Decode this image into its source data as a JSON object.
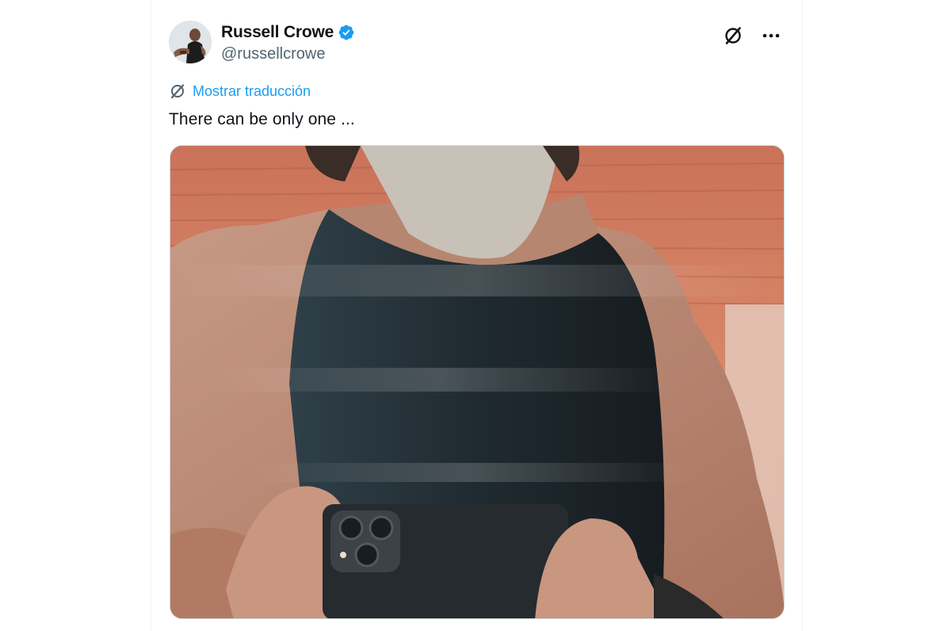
{
  "tweet": {
    "author": {
      "display_name": "Russell Crowe",
      "handle": "@russellcrowe",
      "verified": true,
      "avatar_icon": "profile-photo"
    },
    "translate_link": "Mostrar traducción",
    "text": "There can be only one ...",
    "icons": {
      "header_action": "grok-icon",
      "more": "more-dots-icon",
      "translate": "translate-icon",
      "verified": "verified-badge-icon"
    },
    "media": {
      "type": "photo",
      "subject": "mirror selfie"
    },
    "colors": {
      "link": "#1d9bf0",
      "verified": "#1d9bf0",
      "text": "#0f1419",
      "secondary": "#536471"
    }
  }
}
